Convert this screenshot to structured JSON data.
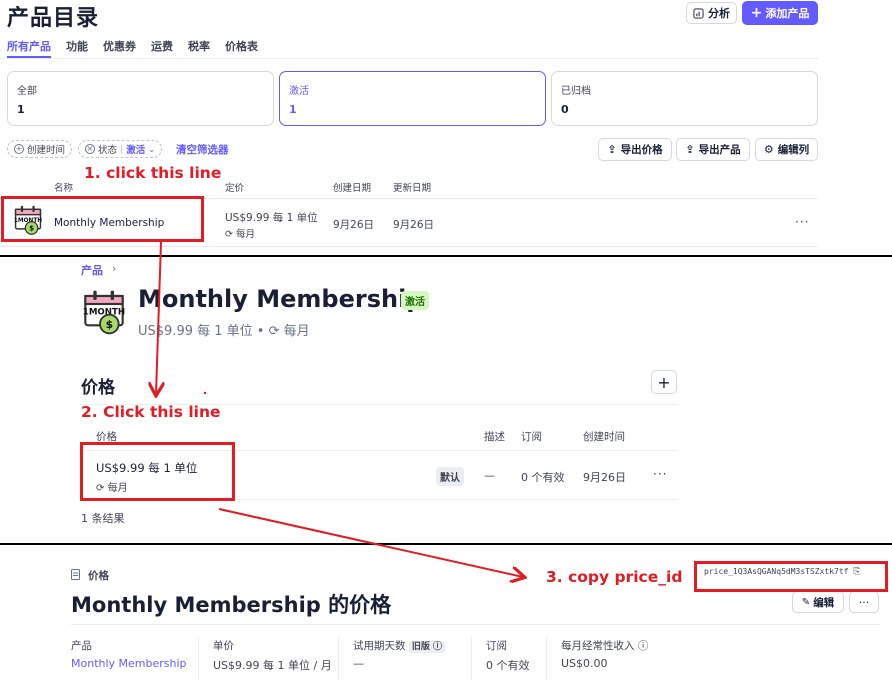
{
  "panel1": {
    "title": "产品目录",
    "analytics_label": "分析",
    "add_product_label": "添加产品",
    "tabs": [
      {
        "label": "所有产品",
        "active": true
      },
      {
        "label": "功能",
        "active": false
      },
      {
        "label": "优惠券",
        "active": false
      },
      {
        "label": "运费",
        "active": false
      },
      {
        "label": "税率",
        "active": false
      },
      {
        "label": "价格表",
        "active": false
      }
    ],
    "cards": [
      {
        "label": "全部",
        "count": "1"
      },
      {
        "label": "激活",
        "count": "1"
      },
      {
        "label": "已归档",
        "count": "0"
      }
    ],
    "filters": {
      "created": "创建时间",
      "status_label": "状态",
      "status_value": "激活",
      "clear": "清空筛选器"
    },
    "actions": {
      "export_prices": "导出价格",
      "export_products": "导出产品",
      "edit_columns": "编辑列"
    },
    "columns": [
      "名称",
      "定价",
      "创建日期",
      "更新日期"
    ],
    "row": {
      "name": "Monthly Membership",
      "price": "US$9.99 每 1 单位",
      "interval": "每月",
      "created": "9月26日",
      "updated": "9月26日",
      "more": "···"
    }
  },
  "panel2": {
    "breadcrumb": "产品",
    "breadcrumb_sep": "›",
    "title": "Monthly Membership",
    "status_badge": "激活",
    "subtitle": "US$9.99 每 1 单位 • ⟳ 每月",
    "prices_heading": "价格",
    "add_label": "+",
    "columns": [
      "价格",
      "描述",
      "订阅",
      "创建时间"
    ],
    "row": {
      "price": "US$9.99 每 1 单位",
      "interval": "每月",
      "default_badge": "默认",
      "description": "—",
      "subscriptions": "0 个有效",
      "created": "9月26日",
      "more": "···"
    },
    "footer": "1 条结果"
  },
  "panel3": {
    "breadcrumb": "价格",
    "title": "Monthly Membership 的价格",
    "price_id": "price_1Q3AsQGANq5dM3sTSZxtk7tf",
    "edit_label": "编辑",
    "more_label": "···",
    "summary": [
      {
        "label": "产品",
        "value": "Monthly Membership",
        "link": true
      },
      {
        "label": "单价",
        "value": "US$9.99 每 1 单位 / 月"
      },
      {
        "label": "试用期天数",
        "extra": "旧版",
        "value": "—"
      },
      {
        "label": "订阅",
        "value": "0 个有效"
      },
      {
        "label": "每月经常性收入",
        "value": "US$0.00"
      }
    ]
  },
  "annotations": {
    "step1": "1. click this line",
    "step2": "2. Click this line",
    "step3": "3. copy price_id",
    "color": "#e31b23"
  },
  "colors": {
    "accent": "#635bff",
    "active_badge_bg": "#d7f7c2",
    "active_badge_text": "#217005"
  }
}
